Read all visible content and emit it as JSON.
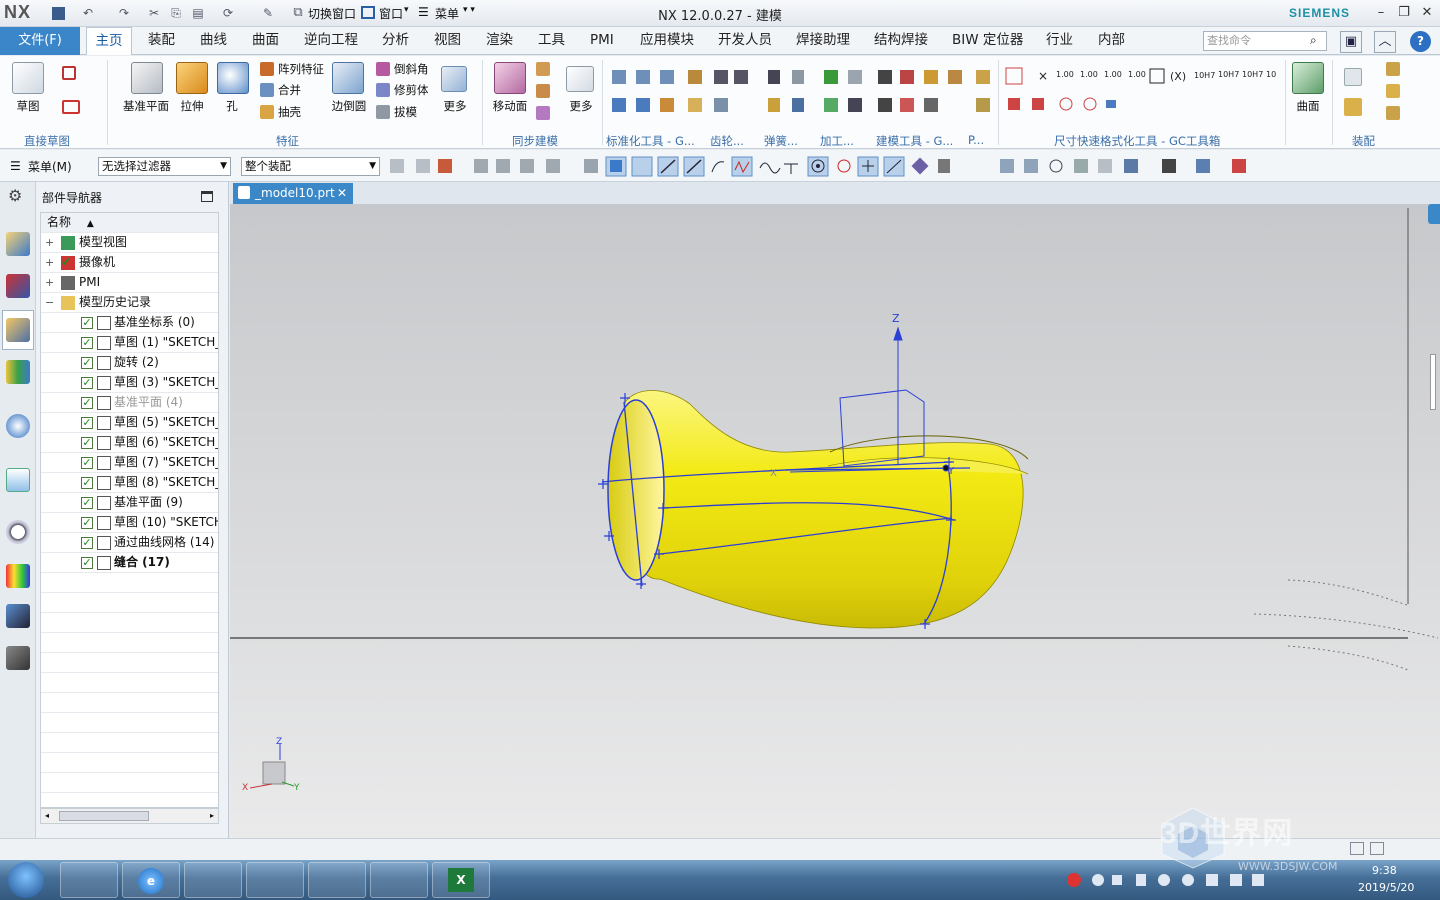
{
  "app": {
    "logo": "NX",
    "window_title": "NX 12.0.0.27 - 建模",
    "brand": "SIEMENS",
    "quick_access": {
      "switch_window": "切换窗口",
      "window": "窗口",
      "menu": "菜单"
    }
  },
  "menu_tabs": [
    "文件(F)",
    "主页",
    "装配",
    "曲线",
    "曲面",
    "逆向工程",
    "分析",
    "视图",
    "渲染",
    "工具",
    "PMI",
    "应用模块",
    "开发人员",
    "焊接助理",
    "结构焊接",
    "BIW 定位器",
    "行业",
    "内部"
  ],
  "active_tab": "主页",
  "search_placeholder": "查找命令",
  "ribbon": {
    "groups": [
      "直接草图",
      "特征",
      "同步建模",
      "标准化工具 - G...",
      "齿轮...",
      "弹簧...",
      "加工...",
      "建模工具 - G...",
      "P...",
      "尺寸快速格式化工具 - GC工具箱",
      "装配"
    ],
    "buttons": {
      "sketch": "草图",
      "datum_plane": "基准平面",
      "extrude": "拉伸",
      "hole": "孔",
      "pattern_feature": "阵列特征",
      "unite": "合并",
      "shell": "抽壳",
      "edge_blend": "边倒圆",
      "chamfer": "倒斜角",
      "trim_body": "修剪体",
      "draft": "拔模",
      "more1": "更多",
      "move_face": "移动面",
      "more2": "更多",
      "surface": "曲面"
    }
  },
  "selection_bar": {
    "menu": "菜单(M)",
    "filter": "无选择过滤器",
    "scope": "整个装配"
  },
  "navigator": {
    "title": "部件导航器",
    "column": "名称",
    "items": [
      {
        "label": "模型视图",
        "level": 0,
        "state": "expand"
      },
      {
        "label": "摄像机",
        "level": 0,
        "state": "expand"
      },
      {
        "label": "PMI",
        "level": 0,
        "state": "expand"
      },
      {
        "label": "模型历史记录",
        "level": 0,
        "state": "collapse"
      },
      {
        "label": "基准坐标系 (0)",
        "level": 1
      },
      {
        "label": "草图 (1) \"SKETCH_",
        "level": 1
      },
      {
        "label": "旋转 (2)",
        "level": 1
      },
      {
        "label": "草图 (3) \"SKETCH_",
        "level": 1
      },
      {
        "label": "基准平面 (4)",
        "level": 1,
        "dim": true
      },
      {
        "label": "草图 (5) \"SKETCH_",
        "level": 1
      },
      {
        "label": "草图 (6) \"SKETCH_",
        "level": 1
      },
      {
        "label": "草图 (7) \"SKETCH_",
        "level": 1
      },
      {
        "label": "草图 (8) \"SKETCH_",
        "level": 1
      },
      {
        "label": "基准平面 (9)",
        "level": 1
      },
      {
        "label": "草图 (10) \"SKETCH",
        "level": 1
      },
      {
        "label": "通过曲线网格 (14)",
        "level": 1
      },
      {
        "label": "缝合 (17)",
        "level": 1,
        "bold": true
      }
    ]
  },
  "document": {
    "tab": "_model10.prt"
  },
  "viewport": {
    "axis_labels": {
      "x": "X",
      "y": "Y",
      "z": "Z"
    },
    "model_color": "#f5ee1a",
    "curve_color": "#2b3fd6"
  },
  "taskbar": {
    "time": "9:38",
    "date": "2019/5/20"
  },
  "watermark": {
    "brand": "3D世界网",
    "url": "WWW.3DSJW.COM"
  }
}
